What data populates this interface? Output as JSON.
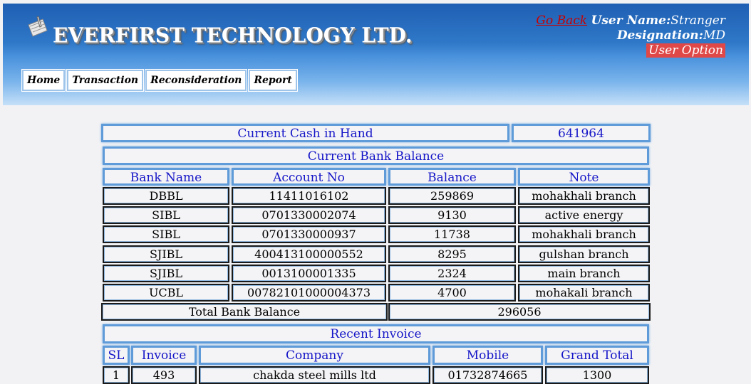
{
  "header": {
    "brand": "EVERFIRST TECHNOLOGY LTD.",
    "go_back": "Go Back",
    "user_name_label": "User Name:",
    "user_name": "Stranger",
    "designation_label": "Designation:",
    "designation": "MD",
    "user_option": "User Option"
  },
  "nav": [
    "Home",
    "Transaction",
    "Reconsideration",
    "Report"
  ],
  "cash": {
    "label": "Current Cash in Hand",
    "value": "641964"
  },
  "bank": {
    "title": "Current Bank Balance",
    "columns": [
      "Bank Name",
      "Account No",
      "Balance",
      "Note"
    ],
    "rows": [
      [
        "DBBL",
        "11411016102",
        "259869",
        "mohakhali branch"
      ],
      [
        "SIBL",
        "0701330002074",
        "9130",
        "active energy"
      ],
      [
        "SIBL",
        "0701330000937",
        "11738",
        "mohakhali branch"
      ],
      [
        "SJIBL",
        "400413100000552",
        "8295",
        "gulshan branch"
      ],
      [
        "SJIBL",
        "0013100001335",
        "2324",
        "main branch"
      ],
      [
        "UCBL",
        "00782101000004373",
        "4700",
        "mohakali branch"
      ]
    ],
    "total_label": "Total Bank Balance",
    "total_value": "296056"
  },
  "invoice": {
    "title": "Recent Invoice",
    "columns": [
      "SL",
      "Invoice",
      "Company",
      "Mobile",
      "Grand Total"
    ],
    "rows": [
      [
        "1",
        "493",
        "chakda steel mills ltd",
        "01732874665",
        "1300"
      ]
    ]
  }
}
